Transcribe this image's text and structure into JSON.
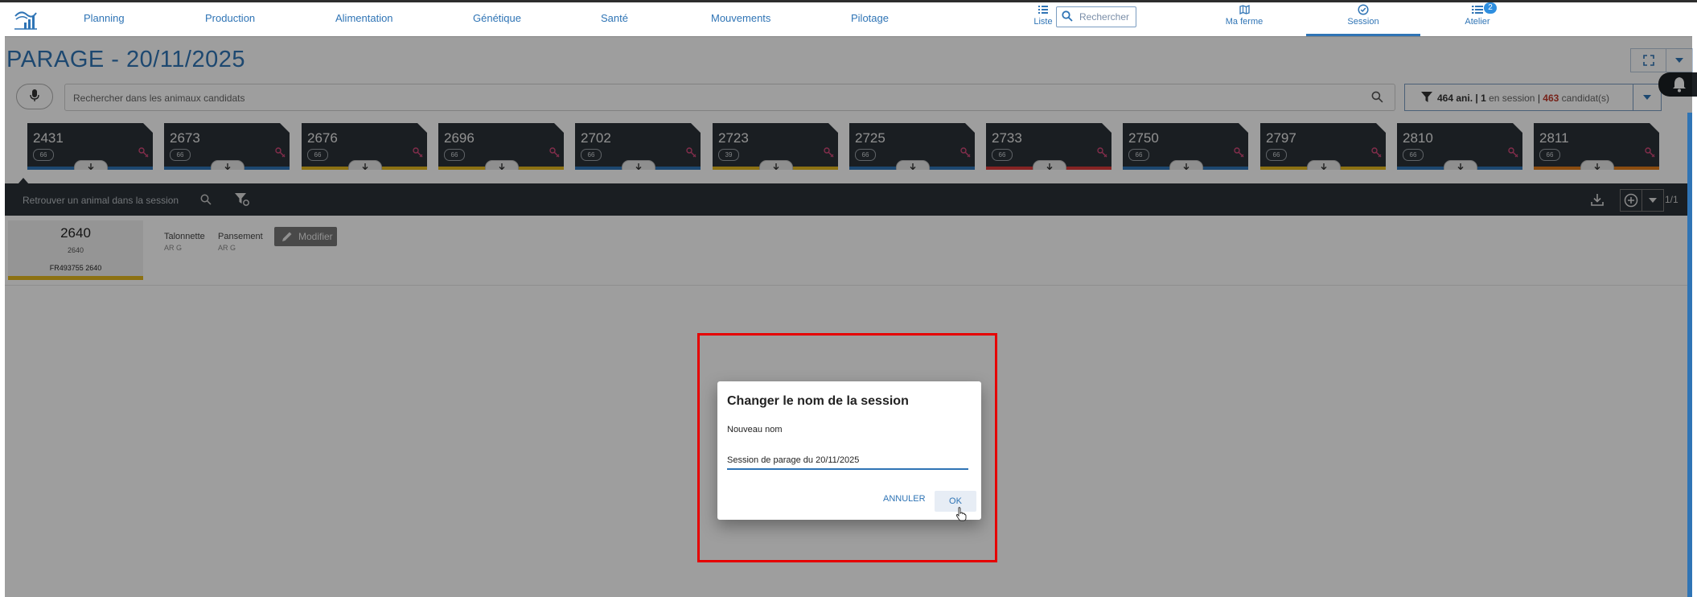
{
  "nav": {
    "links": [
      "Planning",
      "Production",
      "Alimentation",
      "Génétique",
      "Santé",
      "Mouvements",
      "Pilotage"
    ],
    "liste_label": "Liste",
    "search_placeholder": "Rechercher",
    "ferme_label": "Ma ferme",
    "session_label": "Session",
    "atelier_label": "Atelier",
    "atelier_badge": "2"
  },
  "page": {
    "title": "PARAGE - 20/11/2025",
    "search_placeholder": "Rechercher dans les animaux candidats"
  },
  "filter": {
    "animals": "464 ani.",
    "sep1": "|",
    "in_session_count": "1",
    "in_session_label": "en session",
    "sep2": "|",
    "candidates_count": "463",
    "candidates_label": "candidat(s)"
  },
  "cards": [
    {
      "num": "2431",
      "pill": "66",
      "stripe": "#2f74b5"
    },
    {
      "num": "2673",
      "pill": "66",
      "stripe": "#2f74b5"
    },
    {
      "num": "2676",
      "pill": "66",
      "stripe": "#e2b71f"
    },
    {
      "num": "2696",
      "pill": "66",
      "stripe": "#e2b71f"
    },
    {
      "num": "2702",
      "pill": "66",
      "stripe": "#2f74b5"
    },
    {
      "num": "2723",
      "pill": "39",
      "stripe": "#e2b71f"
    },
    {
      "num": "2725",
      "pill": "66",
      "stripe": "#2f74b5"
    },
    {
      "num": "2733",
      "pill": "66",
      "stripe": "#d93a3a"
    },
    {
      "num": "2750",
      "pill": "66",
      "stripe": "#2f74b5"
    },
    {
      "num": "2797",
      "pill": "66",
      "stripe": "#e2b71f"
    },
    {
      "num": "2810",
      "pill": "66",
      "stripe": "#2f74b5"
    },
    {
      "num": "2811",
      "pill": "66",
      "stripe": "#e07b1a"
    }
  ],
  "session_bar": {
    "search_placeholder": "Retrouver un animal dans la session",
    "counter": "1/1"
  },
  "selected_animal": {
    "number": "2640",
    "sub": "2640",
    "id": "FR493755  2640",
    "attr1_label": "Talonnette",
    "attr1_value": "AR G",
    "attr2_label": "Pansement",
    "attr2_value": "AR G",
    "modify_label": "Modifier"
  },
  "dialog": {
    "title": "Changer le nom de la session",
    "label": "Nouveau nom",
    "value": "Session de parage du 20/11/2025",
    "cancel": "ANNULER",
    "ok": "OK"
  }
}
